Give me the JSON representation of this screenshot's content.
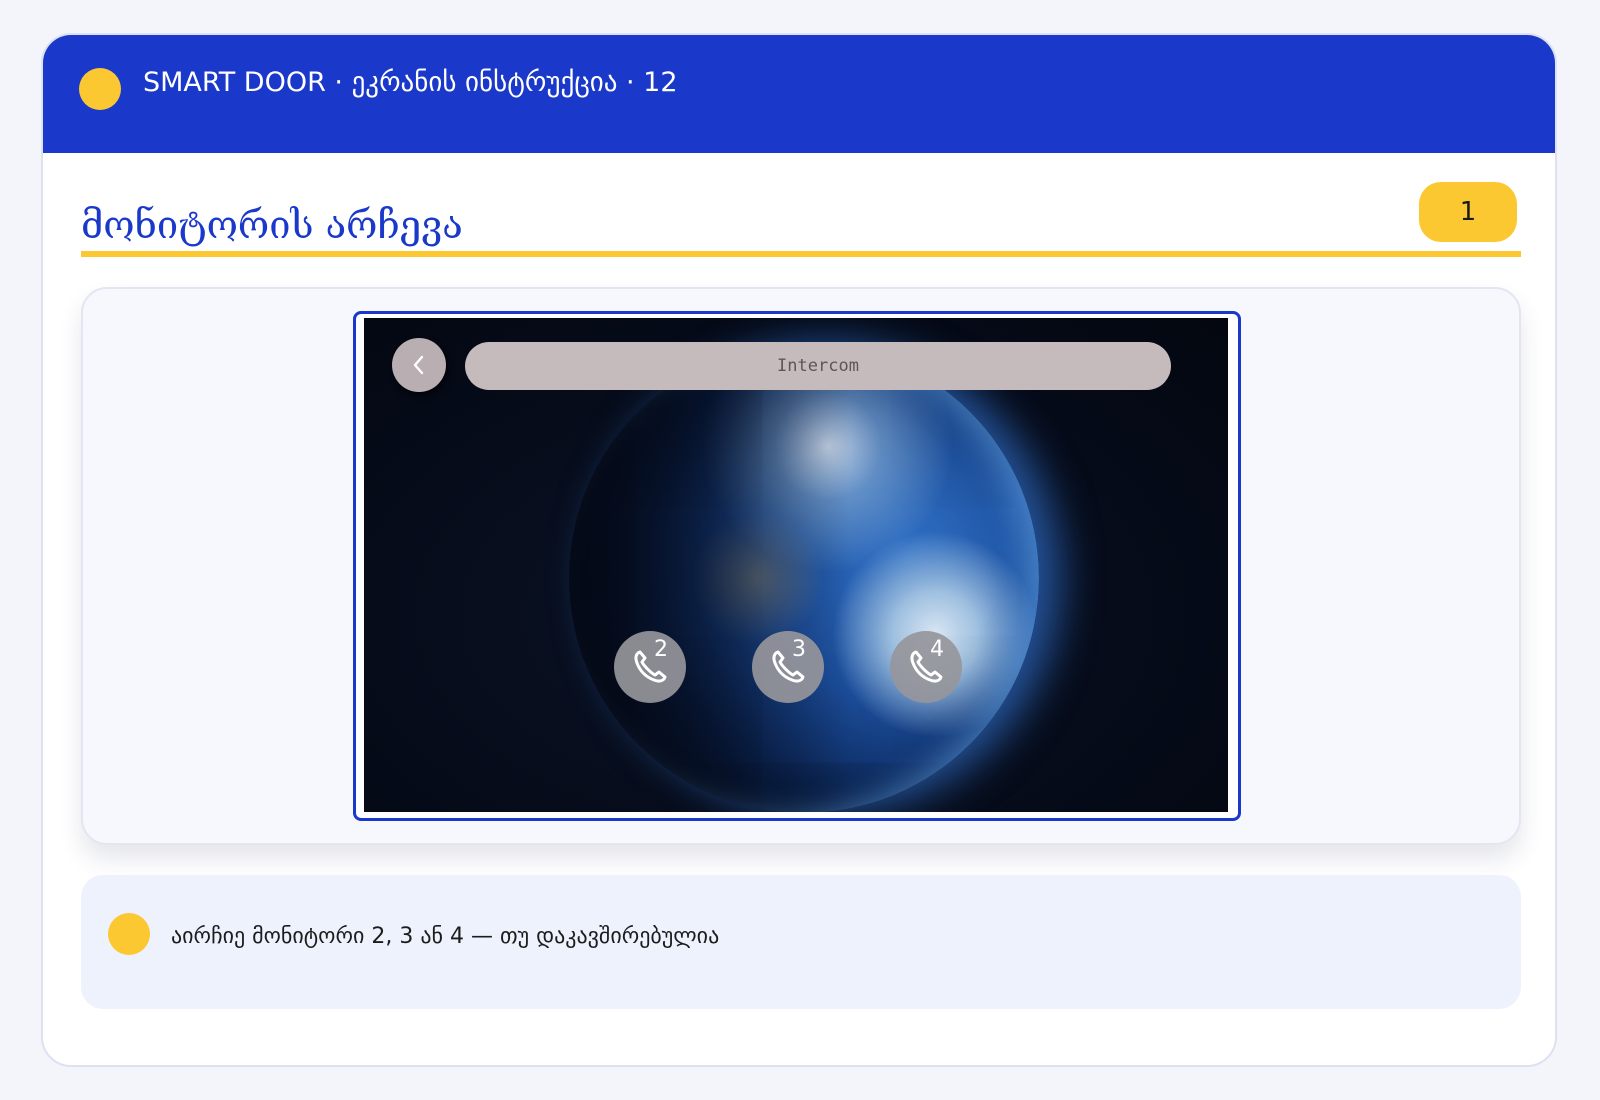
{
  "header": {
    "title": "SMART DOOR · ეკრანის ინსტრუქცია · 12"
  },
  "section": {
    "title": "მონიტორის არჩევა",
    "step": "1"
  },
  "device": {
    "screen_title": "Intercom",
    "monitors": [
      {
        "number": "2"
      },
      {
        "number": "3"
      },
      {
        "number": "4"
      }
    ]
  },
  "note": {
    "text": "აირჩიე მონიტორი 2, 3 ან 4 — თუ დაკავშირებულია"
  },
  "colors": {
    "accent": "#1a38c9",
    "highlight": "#fcc832",
    "note_bg": "#eef2fd"
  },
  "icons": [
    "back-chevron-icon",
    "phone-icon"
  ]
}
